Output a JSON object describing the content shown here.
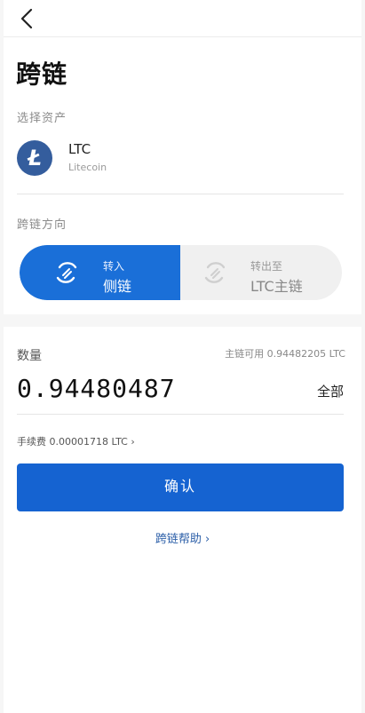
{
  "header": {
    "title": "跨链"
  },
  "asset_section": {
    "label": "选择资产",
    "coin_glyph": "Ł",
    "symbol": "LTC",
    "name": "Litecoin"
  },
  "direction": {
    "label": "跨链方向",
    "left_small": "转入",
    "left_big": "侧链",
    "right_small": "转出至",
    "right_big": "LTC主链",
    "active": "left"
  },
  "quantity": {
    "label": "数量",
    "available": "主链可用 0.94482205 LTC",
    "amount": "0.94480487",
    "all_label": "全部"
  },
  "fee": {
    "text": "手续费 0.00001718 LTC ›"
  },
  "confirm_label": "确认",
  "help_label": "跨链帮助 ›",
  "colors": {
    "accent": "#1563d1",
    "coin": "#345d9d",
    "toggle_active": "#1a6fd8"
  }
}
